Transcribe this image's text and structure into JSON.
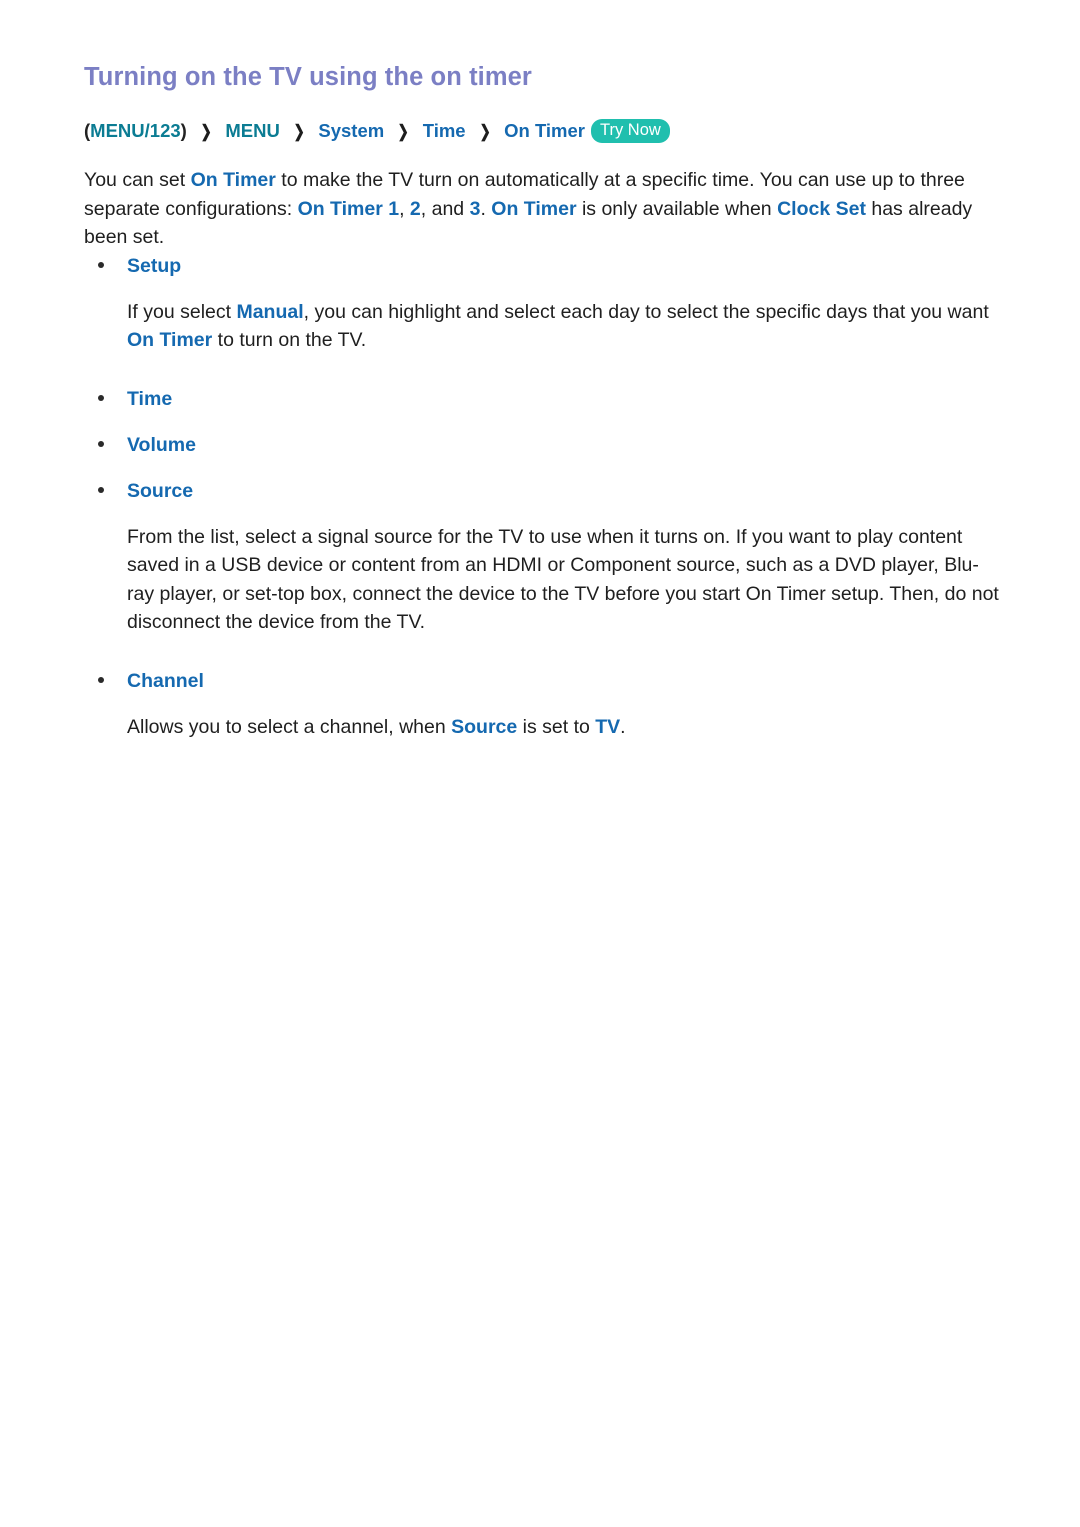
{
  "page": {
    "title": "Turning on the TV using the on timer"
  },
  "breadcrumb": {
    "open_paren": "(",
    "menu123": "MENU/123",
    "close_paren": ")",
    "separator": "❯",
    "menu": "MENU",
    "system": "System",
    "time": "Time",
    "on_timer": "On Timer",
    "try_now_badge": "Try Now"
  },
  "lead_paragraph": {
    "s1": "You can set ",
    "t1": "On Timer",
    "s2": " to make the TV turn on automatically at a specific time. You can use up to three separate configurations: ",
    "t2": "On Timer 1",
    "s3": ", ",
    "t3": "2",
    "s4": ", and ",
    "t4": "3",
    "s5": ". ",
    "t5": "On Timer",
    "s6": " is only available when ",
    "t6": "Clock Set",
    "s7": " has already been set."
  },
  "sections": {
    "setup": {
      "label": "Setup",
      "body": {
        "s1": "If you select ",
        "t1": "Manual",
        "s2": ", you can highlight and select each day to select the specific days that you want ",
        "t2": "On Timer",
        "s3": " to turn on the TV."
      }
    },
    "time": {
      "label": "Time"
    },
    "volume": {
      "label": "Volume"
    },
    "source": {
      "label": "Source",
      "body": "From the list, select a signal source for the TV to use when it turns on. If you want to play content saved in a USB device or content from an HDMI or Component source, such as a DVD player, Blu-ray player, or set-top box, connect the device to the TV before you start On Timer setup. Then, do not disconnect the device from the TV."
    },
    "channel": {
      "label": "Channel",
      "body": {
        "s1": "Allows you to select a channel, when ",
        "t1": "Source",
        "s2": " is set to ",
        "t2": "TV",
        "s3": "."
      }
    }
  },
  "colors": {
    "title_purple": "#7b7fc4",
    "link_blue": "#1569b0",
    "breadcrumb_teal": "#0b7c93",
    "badge_teal": "#20bfae",
    "body_text": "#1f1f1f"
  }
}
